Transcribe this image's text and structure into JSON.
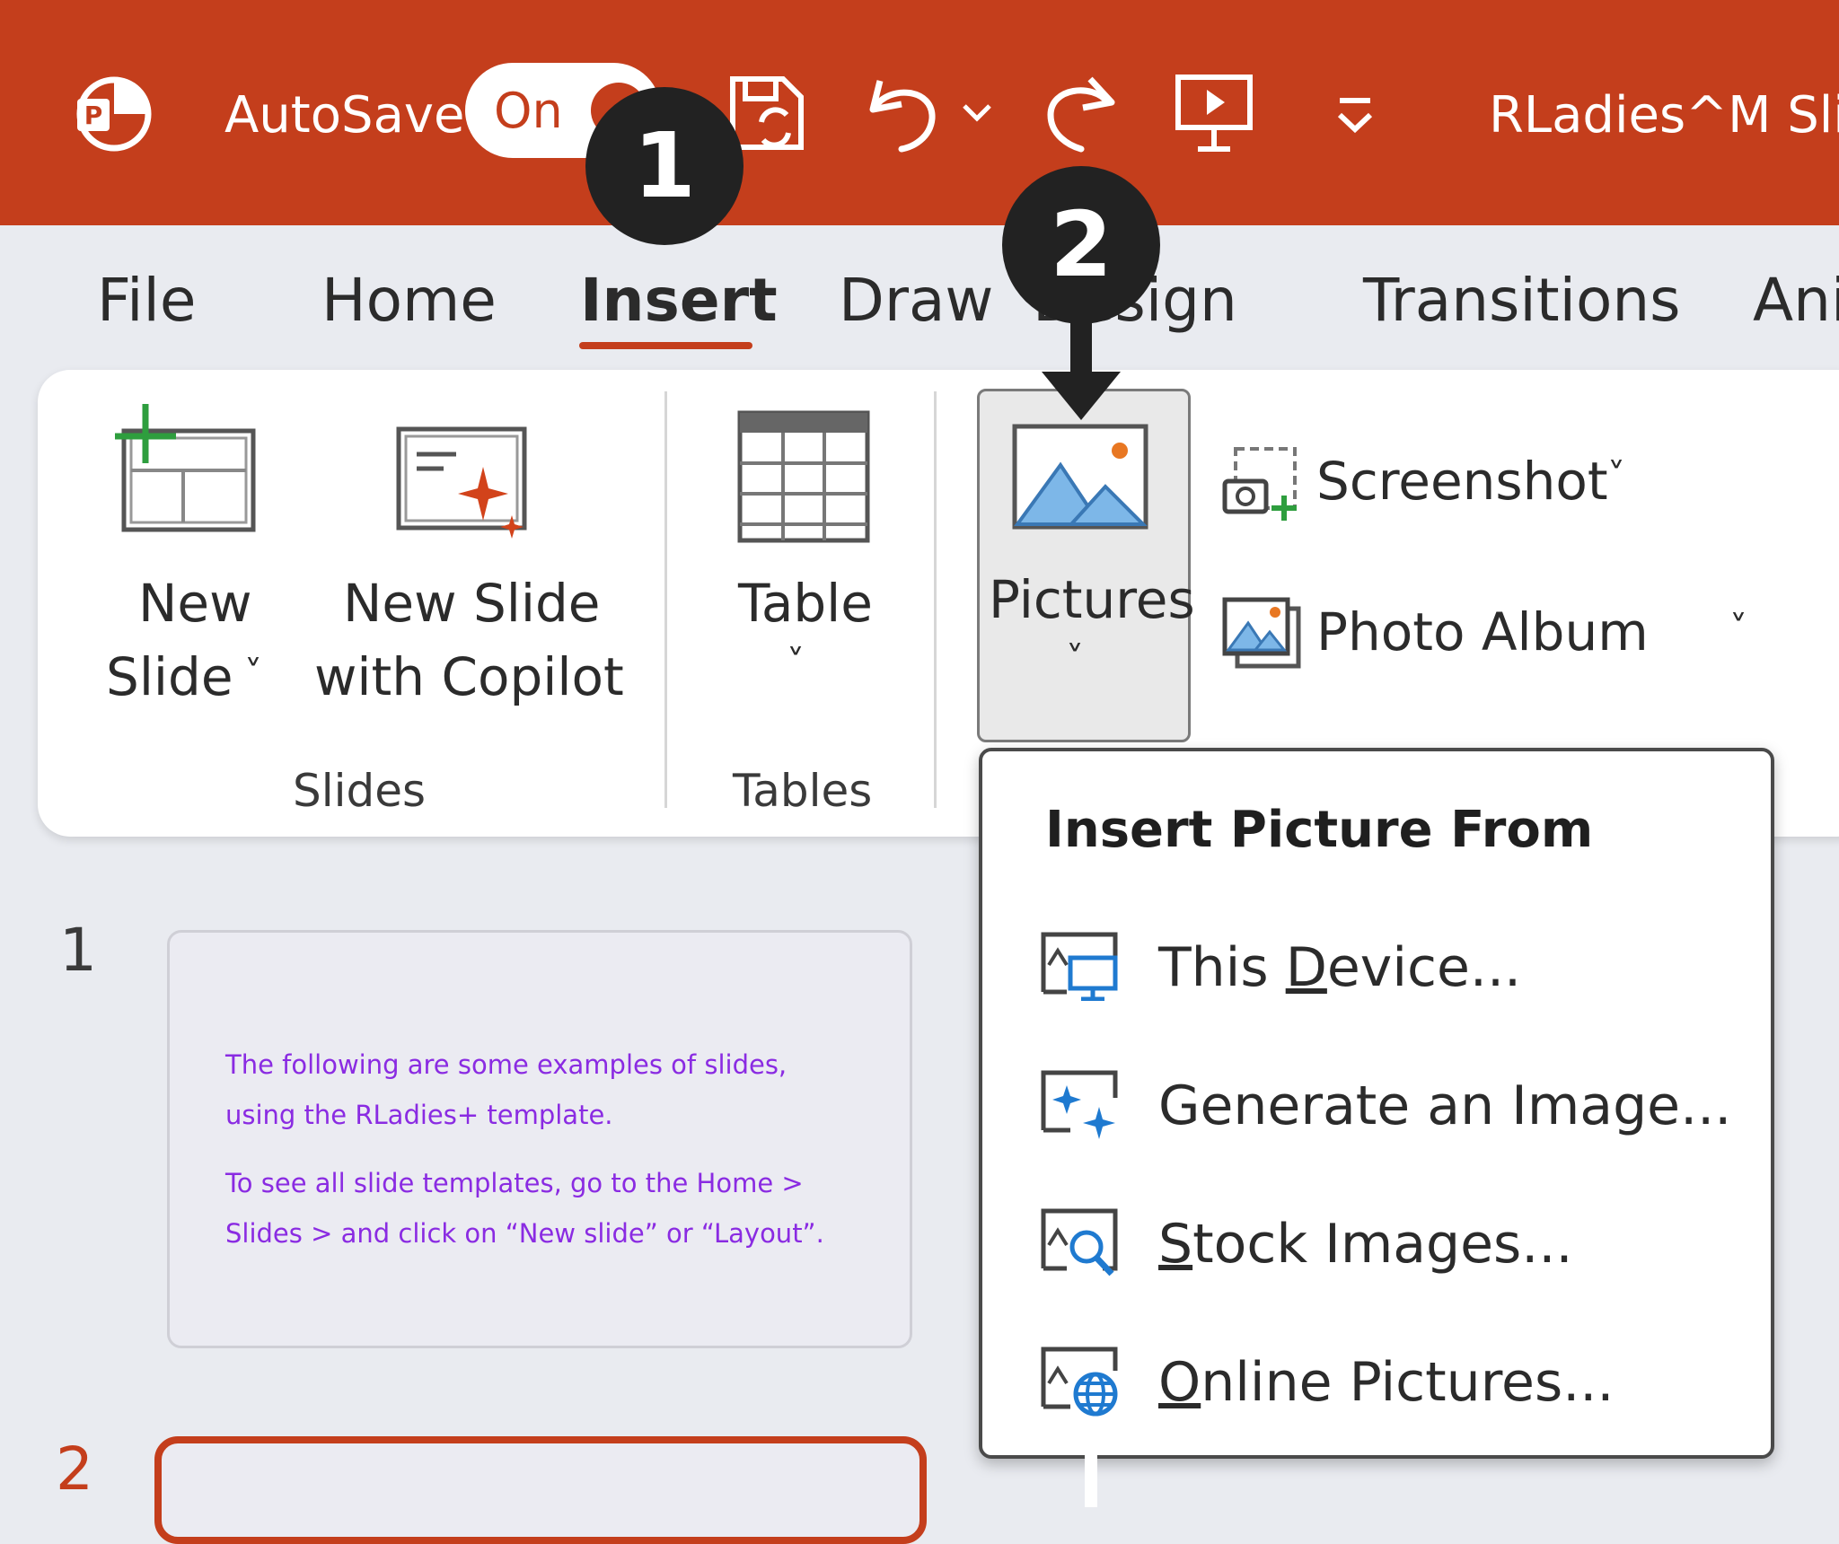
{
  "app": {
    "autosave_label": "AutoSave",
    "autosave_state": "On",
    "doc_title": "RLadies^M Sli"
  },
  "tabs": [
    {
      "label": "File"
    },
    {
      "label": "Home"
    },
    {
      "label": "Insert"
    },
    {
      "label": "Draw"
    },
    {
      "label": "Design"
    },
    {
      "label": "Transitions"
    },
    {
      "label": "Ani"
    }
  ],
  "ribbon": {
    "new_slide": {
      "line1": "New",
      "line2": "Slide"
    },
    "new_slide_copilot": {
      "line1": "New Slide",
      "line2": "with Copilot"
    },
    "table": {
      "label": "Table"
    },
    "pictures": {
      "label": "Pictures"
    },
    "screenshot": {
      "label": "Screenshot"
    },
    "photo_album": {
      "label": "Photo Album"
    },
    "groups": {
      "slides": "Slides",
      "tables": "Tables"
    }
  },
  "dropdown": {
    "header": "Insert Picture From",
    "items": [
      {
        "label": "This Device...",
        "pre": "This ",
        "key": "D",
        "post": "evice..."
      },
      {
        "label": "Generate an Image...",
        "pre": "Generate an Image...",
        "key": "",
        "post": ""
      },
      {
        "label": "Stock Images...",
        "pre": "",
        "key": "S",
        "post": "tock Images..."
      },
      {
        "label": "Online Pictures...",
        "pre": "",
        "key": "O",
        "post": "nline Pictures..."
      }
    ]
  },
  "slides": [
    {
      "number": "1",
      "text_lines": [
        "The following are some examples of slides,",
        "using the RLadies+ template.",
        "To see all slide templates, go to the Home >",
        "Slides > and click on “New slide” or “Layout”."
      ]
    },
    {
      "number": "2"
    }
  ],
  "annotations": {
    "step1": "1",
    "step2": "2"
  },
  "colors": {
    "titlebar": "#c43e1c",
    "accent": "#c43e1c",
    "thumb_text": "#8a2be2",
    "background": "#e9ebf0"
  }
}
